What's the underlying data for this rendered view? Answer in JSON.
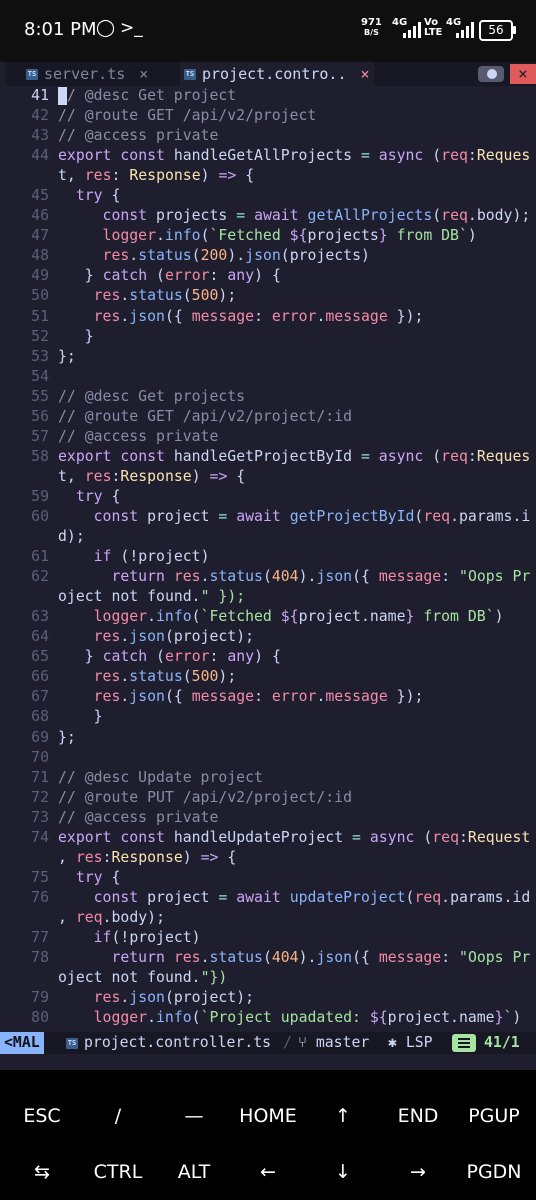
{
  "status_bar": {
    "time": "8:01 PM",
    "net_speed_value": "971",
    "net_speed_unit": "B/S",
    "network_1": "4G",
    "volte": "Vo LTE",
    "network_2": "4G",
    "battery": "56"
  },
  "editor": {
    "tabs": [
      {
        "label": "server.ts",
        "icon": "typescript-file-icon",
        "active": false
      },
      {
        "label": "project.contro..",
        "icon": "typescript-file-icon",
        "active": true
      }
    ],
    "close_glyph": "×",
    "window_close_glyph": "×",
    "lines": [
      {
        "num": "41",
        "text": "// @desc Get project"
      },
      {
        "num": "42",
        "text": "// @route GET /api/v2/project"
      },
      {
        "num": "43",
        "text": "// @access private"
      },
      {
        "num": "44",
        "text": "export const handleGetAllProjects = async (req:Reques"
      },
      {
        "num": "",
        "text": "t, res: Response) => {"
      },
      {
        "num": "45",
        "text": "  try {"
      },
      {
        "num": "46",
        "text": "     const projects = await getAllProjects(req.body);"
      },
      {
        "num": "47",
        "text": "     logger.info(`Fetched ${projects} from DB`)"
      },
      {
        "num": "48",
        "text": "     res.status(200).json(projects)"
      },
      {
        "num": "49",
        "text": "   } catch (error: any) {"
      },
      {
        "num": "50",
        "text": "    res.status(500);"
      },
      {
        "num": "51",
        "text": "    res.json({ message: error.message });"
      },
      {
        "num": "52",
        "text": "   }"
      },
      {
        "num": "53",
        "text": "};"
      },
      {
        "num": "54",
        "text": ""
      },
      {
        "num": "55",
        "text": "// @desc Get projects"
      },
      {
        "num": "56",
        "text": "// @route GET /api/v2/project/:id"
      },
      {
        "num": "57",
        "text": "// @access private"
      },
      {
        "num": "58",
        "text": "export const handleGetProjectById = async (req:Reques"
      },
      {
        "num": "",
        "text": "t, res:Response) => {"
      },
      {
        "num": "59",
        "text": "  try {"
      },
      {
        "num": "60",
        "text": "    const project = await getProjectById(req.params.i"
      },
      {
        "num": "",
        "text": "d);"
      },
      {
        "num": "61",
        "text": "    if (!project)"
      },
      {
        "num": "62",
        "text": "      return res.status(404).json({ message: \"Oops Pr"
      },
      {
        "num": "",
        "text": "oject not found.\" });"
      },
      {
        "num": "63",
        "text": "    logger.info(`Fetched ${project.name} from DB`)"
      },
      {
        "num": "64",
        "text": "    res.json(project);"
      },
      {
        "num": "65",
        "text": "   } catch (error: any) {"
      },
      {
        "num": "66",
        "text": "    res.status(500);"
      },
      {
        "num": "67",
        "text": "    res.json({ message: error.message });"
      },
      {
        "num": "68",
        "text": "    }"
      },
      {
        "num": "69",
        "text": "};"
      },
      {
        "num": "70",
        "text": ""
      },
      {
        "num": "71",
        "text": "// @desc Update project"
      },
      {
        "num": "72",
        "text": "// @route PUT /api/v2/project/:id"
      },
      {
        "num": "73",
        "text": "// @access private"
      },
      {
        "num": "74",
        "text": "export const handleUpdateProject = async (req:Request"
      },
      {
        "num": "",
        "text": ", res:Response) => {"
      },
      {
        "num": "75",
        "text": "  try {"
      },
      {
        "num": "76",
        "text": "    const project = await updateProject(req.params.id"
      },
      {
        "num": "",
        "text": ", req.body);"
      },
      {
        "num": "77",
        "text": "    if(!project)"
      },
      {
        "num": "78",
        "text": "      return res.status(404).json({ message: \"Oops Pr"
      },
      {
        "num": "",
        "text": "oject not found.\"})"
      },
      {
        "num": "79",
        "text": "    res.json(project);"
      },
      {
        "num": "80",
        "text": "    logger.info(`Project upadated: ${project.name}`)"
      }
    ],
    "status_line": {
      "mode": "<MAL",
      "file": "project.controller.ts",
      "branch": "master",
      "lsp": "LSP",
      "position": "41/1"
    }
  },
  "keys": {
    "row1": [
      "ESC",
      "/",
      "—",
      "HOME",
      "↑",
      "END",
      "PGUP"
    ],
    "row2": [
      "⇆",
      "CTRL",
      "ALT",
      "←",
      "↓",
      "→",
      "PGDN"
    ]
  },
  "colors": {
    "editor_bg": "#1e1e2e",
    "comment": "#8a8ca5",
    "keyword": "#cba6f7",
    "function": "#89b4fa",
    "type": "#f9e2af",
    "string": "#a6e3a1",
    "number": "#fab387"
  }
}
